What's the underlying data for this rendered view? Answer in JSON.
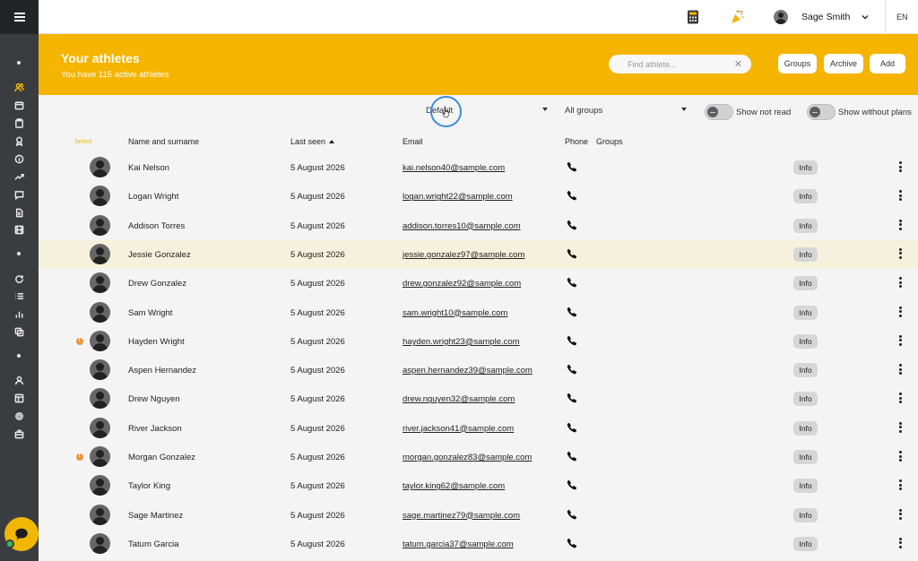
{
  "header": {
    "title": "Your athletes",
    "subtitle": "You have 115 active athletes",
    "search_placeholder": "Find athlete...",
    "groups_button": "Groups",
    "archive_button": "Archive",
    "add_button": "Add"
  },
  "topbar": {
    "user_name": "Sage Smith",
    "language": "EN"
  },
  "filters": {
    "sort_select": "Default",
    "group_select": "All groups",
    "toggle_not_read": "Show not read",
    "toggle_without_plans": "Show without plans"
  },
  "table": {
    "columns": {
      "select": "Select",
      "name": "Name and surname",
      "last_seen": "Last seen",
      "email": "Email",
      "phone": "Phone",
      "groups": "Groups"
    },
    "info_label": "Info",
    "rows": [
      {
        "name": "Kai Nelson",
        "last_seen": "5 August 2026",
        "email": "kai.nelson40@sample.com",
        "warning": false,
        "highlight": false
      },
      {
        "name": "Logan Wright",
        "last_seen": "5 August 2026",
        "email": "logan.wright22@sample.com",
        "warning": false,
        "highlight": false
      },
      {
        "name": "Addison Torres",
        "last_seen": "5 August 2026",
        "email": "addison.torres10@sample.com",
        "warning": false,
        "highlight": false
      },
      {
        "name": "Jessie Gonzalez",
        "last_seen": "5 August 2026",
        "email": "jessie.gonzalez97@sample.com",
        "warning": false,
        "highlight": true
      },
      {
        "name": "Drew Gonzalez",
        "last_seen": "5 August 2026",
        "email": "drew.gonzalez92@sample.com",
        "warning": false,
        "highlight": false
      },
      {
        "name": "Sam Wright",
        "last_seen": "5 August 2026",
        "email": "sam.wright10@sample.com",
        "warning": false,
        "highlight": false
      },
      {
        "name": "Hayden Wright",
        "last_seen": "5 August 2026",
        "email": "hayden.wright23@sample.com",
        "warning": true,
        "highlight": false
      },
      {
        "name": "Aspen Hernandez",
        "last_seen": "5 August 2026",
        "email": "aspen.hernandez39@sample.com",
        "warning": false,
        "highlight": false
      },
      {
        "name": "Drew Nguyen",
        "last_seen": "5 August 2026",
        "email": "drew.nguyen32@sample.com",
        "warning": false,
        "highlight": false
      },
      {
        "name": "River Jackson",
        "last_seen": "5 August 2026",
        "email": "river.jackson41@sample.com",
        "warning": false,
        "highlight": false
      },
      {
        "name": "Morgan Gonzalez",
        "last_seen": "5 August 2026",
        "email": "morgan.gonzalez83@sample.com",
        "warning": true,
        "highlight": false
      },
      {
        "name": "Taylor King",
        "last_seen": "5 August 2026",
        "email": "taylor.king62@sample.com",
        "warning": false,
        "highlight": false
      },
      {
        "name": "Sage Martinez",
        "last_seen": "5 August 2026",
        "email": "sage.martinez79@sample.com",
        "warning": false,
        "highlight": false
      },
      {
        "name": "Tatum Garcia",
        "last_seen": "5 August 2026",
        "email": "tatum.garcia37@sample.com",
        "warning": false,
        "highlight": false
      }
    ]
  },
  "colors": {
    "accent": "#f5b400",
    "sidebar": "#3a3d3f",
    "highlight_row": "#f5f1dc",
    "warning": "#e9973a",
    "online": "#2fbf4d"
  },
  "icons": {
    "topbar": [
      "calculator-icon",
      "party-popper-icon",
      "user-avatar-icon",
      "chevron-down-icon"
    ],
    "row": [
      "avatar-icon",
      "phone-icon",
      "kebab-menu-icon",
      "warning-icon"
    ]
  }
}
